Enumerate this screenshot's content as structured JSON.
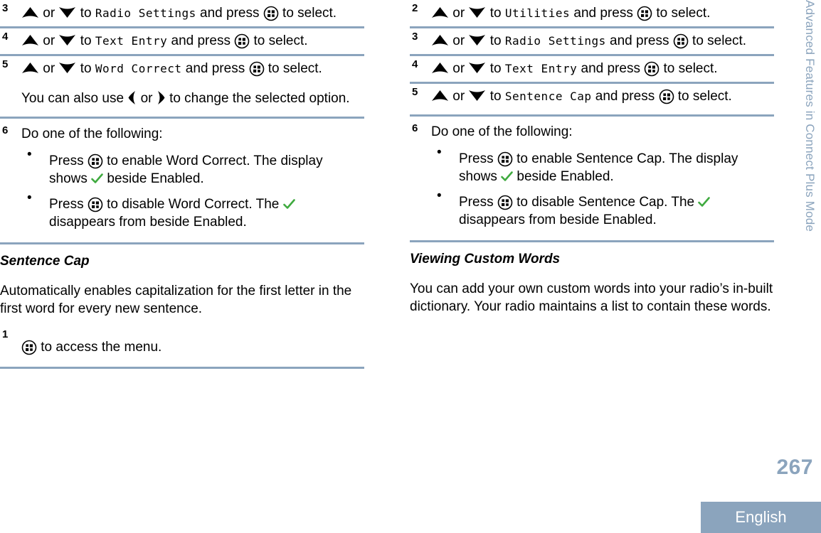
{
  "document": {
    "running_head": "Advanced Features in Connect Plus Mode",
    "page_number": "267",
    "language_tab": "English",
    "accent_color": "#8ba4bd",
    "check_color": "#3faa3f"
  },
  "icons": {
    "menu": "menu-button-icon",
    "up": "up-arrow-icon",
    "down": "down-arrow-icon",
    "left": "left-arrow-icon",
    "right": "right-arrow-icon",
    "check": "green-checkmark-icon"
  },
  "left_column": {
    "steps": [
      {
        "number": "3",
        "pre_up": "",
        "or": "or",
        "to": "to",
        "menu_item": "Radio Settings",
        "and_press": "and press",
        "tail": "to select."
      },
      {
        "number": "4",
        "or": "or",
        "to": "to",
        "menu_item": "Text Entry",
        "and_press": "and press",
        "tail": "to select."
      },
      {
        "number": "5",
        "or": "or",
        "to": "to",
        "menu_item": "Word Correct",
        "and_press": "and press",
        "tail": "to select.",
        "note_pre": "You can also use",
        "note_or": "or",
        "note_post": "to change the selected option."
      },
      {
        "number": "6",
        "intro": "Do one of the following:",
        "bullets": [
          {
            "pre": "Press",
            "mid": "to enable Word Correct. The display shows",
            "post": "beside Enabled."
          },
          {
            "pre": "Press",
            "mid": "to disable Word Correct. The",
            "post": "disappears from beside Enabled."
          }
        ]
      }
    ],
    "section": {
      "heading": "Sentence Cap",
      "paragraph": "Automatically enables capitalization for the first letter in the first word for every new sentence."
    },
    "final_step": {
      "number": "1",
      "text": "to access the menu."
    }
  },
  "right_column": {
    "steps": [
      {
        "number": "2",
        "or": "or",
        "to": "to",
        "menu_item": "Utilities",
        "and_press": "and press",
        "tail": "to select."
      },
      {
        "number": "3",
        "or": "or",
        "to": "to",
        "menu_item": "Radio Settings",
        "and_press": "and press",
        "tail": "to select."
      },
      {
        "number": "4",
        "or": "or",
        "to": "to",
        "menu_item": "Text Entry",
        "and_press": "and press",
        "tail": "to select."
      },
      {
        "number": "5",
        "or": "or",
        "to": "to",
        "menu_item": "Sentence Cap",
        "and_press": "and press",
        "tail": "to select."
      },
      {
        "number": "6",
        "intro": "Do one of the following:",
        "bullets": [
          {
            "pre": "Press",
            "mid": "to enable Sentence Cap. The display shows",
            "post": "beside Enabled."
          },
          {
            "pre": "Press",
            "mid": "to disable Sentence Cap. The",
            "post": "disappears from beside Enabled."
          }
        ]
      }
    ],
    "section": {
      "heading": "Viewing Custom Words",
      "paragraph": "You can add your own custom words into your radio’s in-built dictionary. Your radio maintains a list to contain these words."
    }
  }
}
